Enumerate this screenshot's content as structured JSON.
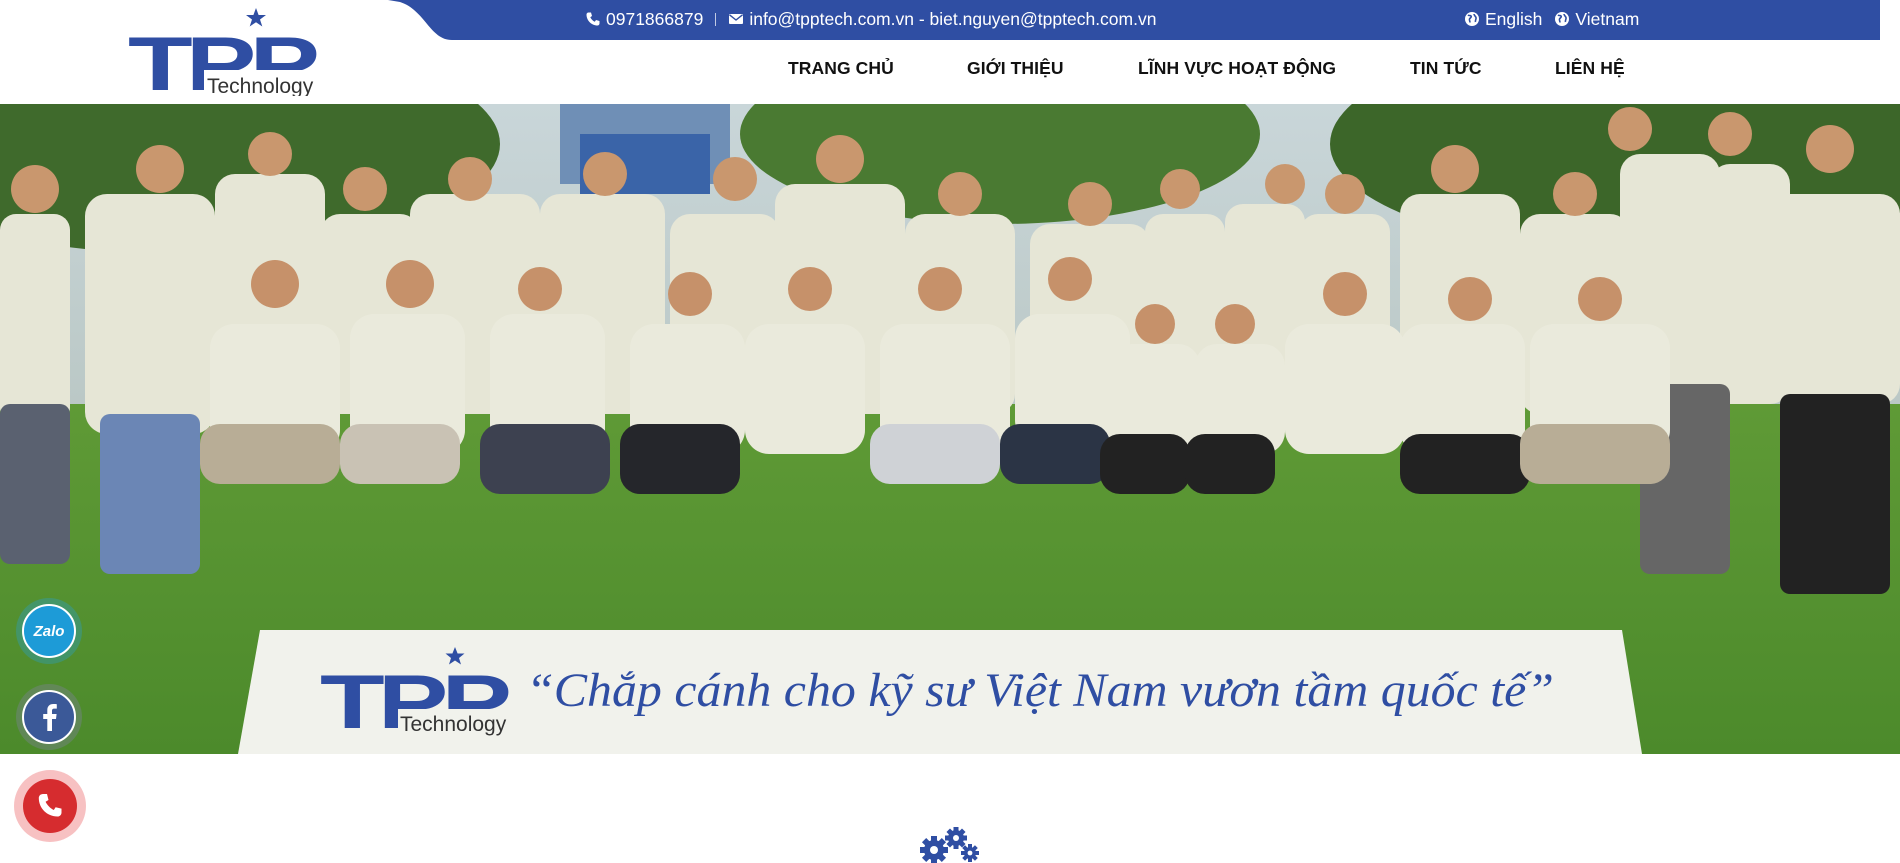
{
  "colors": {
    "brand_blue": "#2f4ea3",
    "nav_text": "#111111",
    "phone_red": "#d62c2f",
    "zalo_blue": "#1d9bd7",
    "facebook_blue": "#3b5998"
  },
  "topbar": {
    "phone": "0971866879",
    "emails": "info@tpptech.com.vn - biet.nguyen@tpptech.com.vn",
    "phone_icon": "phone-icon",
    "email_icon": "envelope-icon",
    "languages": [
      {
        "label": "English",
        "icon": "globe-icon"
      },
      {
        "label": "Vietnam",
        "icon": "globe-icon"
      }
    ]
  },
  "logo": {
    "mark": "TPP",
    "subtitle": "Technology"
  },
  "nav": {
    "items": [
      {
        "label": "TRANG CHỦ"
      },
      {
        "label": "GIỚI THIỆU"
      },
      {
        "label": "LĨNH VỰC HOẠT ĐỘNG"
      },
      {
        "label": "TIN TỨC"
      },
      {
        "label": "LIÊN HỆ"
      }
    ]
  },
  "hero": {
    "banner_logo_mark": "TPP",
    "banner_logo_subtitle": "Technology",
    "slogan": "“Chắp cánh cho kỹ sư Việt Nam vươn tầm quốc tế”",
    "image_description_icon": "group-photo"
  },
  "floating": {
    "zalo_label": "Zalo",
    "facebook_icon": "facebook-icon",
    "phone_icon": "phone-icon"
  },
  "section": {
    "divider_icon": "gears-icon"
  }
}
